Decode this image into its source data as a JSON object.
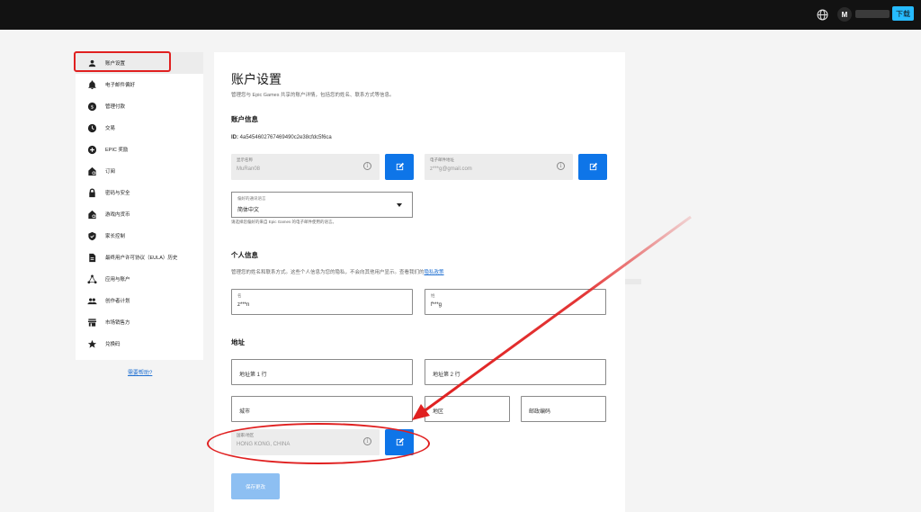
{
  "topbar": {
    "avatar_initial": "M",
    "download_label": "下载"
  },
  "sidebar": {
    "items": [
      {
        "label": "账户设置",
        "icon": "person-icon"
      },
      {
        "label": "电子邮件偏好",
        "icon": "bell-icon"
      },
      {
        "label": "管理付款",
        "icon": "dollar-icon"
      },
      {
        "label": "交易",
        "icon": "clock-icon"
      },
      {
        "label": "EPIC 奖励",
        "icon": "plus-circle-icon"
      },
      {
        "label": "订阅",
        "icon": "subscription-icon"
      },
      {
        "label": "密码与安全",
        "icon": "lock-icon"
      },
      {
        "label": "游戏内货币",
        "icon": "coin-icon"
      },
      {
        "label": "家长控制",
        "icon": "shield-icon"
      },
      {
        "label": "最终用户许可协议（EULA）历史",
        "icon": "document-icon"
      },
      {
        "label": "应用与账户",
        "icon": "apps-icon"
      },
      {
        "label": "创作者计划",
        "icon": "people-icon"
      },
      {
        "label": "市场销售方",
        "icon": "store-icon"
      },
      {
        "label": "兑换码",
        "icon": "star-icon"
      }
    ],
    "help_link": "需要帮助?"
  },
  "main": {
    "title": "账户设置",
    "description": "管理您与 Epic Games 共享的账户详情，包括您的姓名、联系方式等信息。",
    "account_info_heading": "账户信息",
    "id_label": "ID:",
    "id_value": "4a5454602767469490c2e38cfdc5f6ca",
    "display_name": {
      "label": "显示名称",
      "value": "MuRan08"
    },
    "email": {
      "label": "电子邮件地址",
      "value": "z***g@gmail.com"
    },
    "language": {
      "label": "偏好的通讯语言",
      "value": "简体中文"
    },
    "language_hint": "请选择您偏好的来自 Epic Games 的电子邮件使用的语言。",
    "personal_heading": "个人信息",
    "personal_desc": "管理您的姓名和联系方式。这些个人信息为您的隐私，不会向其他用户显示。查看我们的",
    "privacy_link": "隐私政策",
    "first_name": {
      "label": "名",
      "value": "z***n"
    },
    "last_name": {
      "label": "姓",
      "value": "f***g"
    },
    "address_heading": "地址",
    "address1_placeholder": "地址第 1 行",
    "address2_placeholder": "地址第 2 行",
    "city_placeholder": "城市",
    "region_placeholder": "地区",
    "postal_placeholder": "邮政编码",
    "country": {
      "label": "国家/地区",
      "value": "HONG KONG, CHINA"
    },
    "save_label": "保存更改"
  },
  "colors": {
    "accent_blue": "#0e75e8",
    "annotation_red": "#e02020",
    "download_cyan": "#26bbff"
  }
}
